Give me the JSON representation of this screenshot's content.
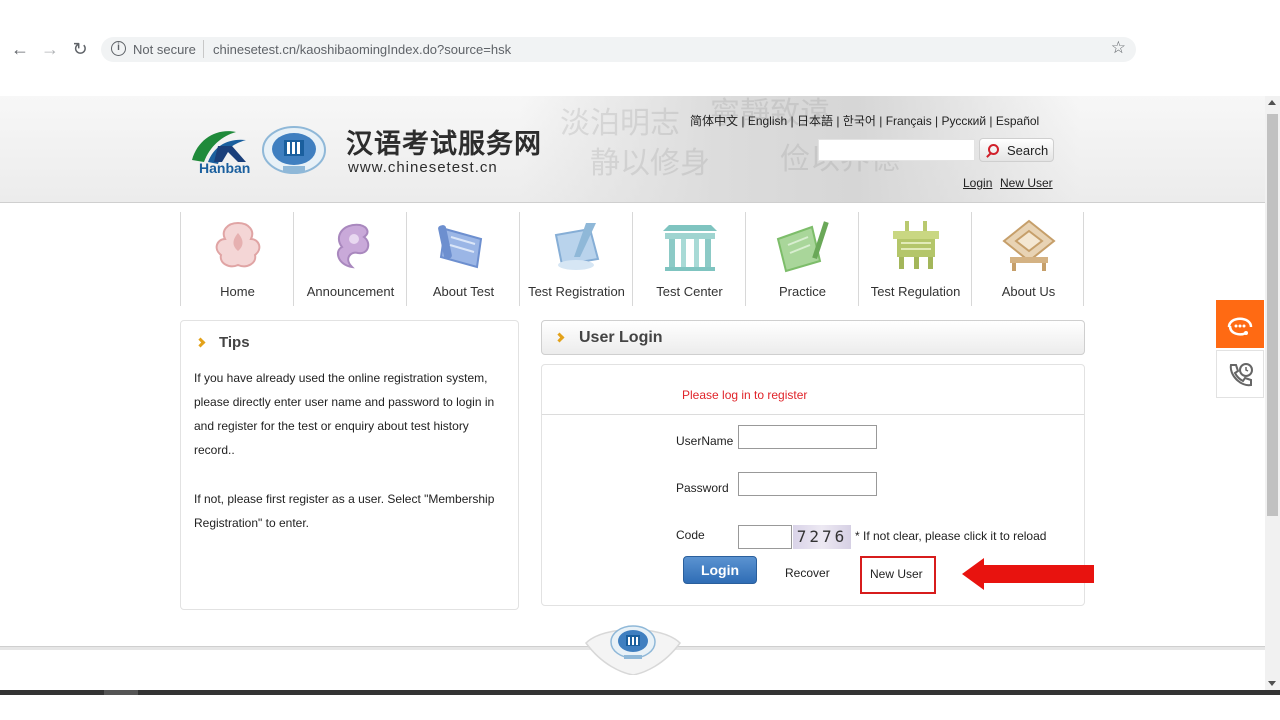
{
  "browser": {
    "security_label": "Not secure",
    "url": "chinesetest.cn/kaoshibaomingIndex.do?source=hsk"
  },
  "header": {
    "logo_text": "Hanban",
    "site_title": "汉语考试服务网",
    "site_url": "www.chinesetest.cn",
    "languages": [
      "简体中文",
      "English",
      "日本語",
      "한국어",
      "Français",
      "Русский",
      "Español"
    ],
    "search_label": "Search",
    "login_label": "Login",
    "new_user_label": "New User"
  },
  "nav": {
    "items": [
      {
        "label": "Home",
        "icon": "home-icon"
      },
      {
        "label": "Announcement",
        "icon": "announcement-icon"
      },
      {
        "label": "About Test",
        "icon": "scroll-icon"
      },
      {
        "label": "Test Registration",
        "icon": "registration-icon"
      },
      {
        "label": "Test Center",
        "icon": "gate-icon"
      },
      {
        "label": "Practice",
        "icon": "brush-icon"
      },
      {
        "label": "Test Regulation",
        "icon": "bronze-vessel-icon"
      },
      {
        "label": "About Us",
        "icon": "seal-icon"
      }
    ]
  },
  "tips": {
    "title": "Tips",
    "paragraph1": "If you have already used the online registration system, please directly enter user name and password to login in and register for the test or enquiry about test history record..",
    "paragraph2": "If not, please first register as a user. Select \"Membership Registration\" to enter."
  },
  "login": {
    "title": "User Login",
    "notice": "Please log in to register",
    "username_label": "UserName",
    "password_label": "Password",
    "code_label": "Code",
    "captcha_value": "7276",
    "captcha_hint": "*  If not clear, please click it to reload",
    "login_button": "Login",
    "recover_label": "Recover",
    "new_user_label": "New User"
  },
  "colors": {
    "accent_orange": "#ff6a13",
    "notice_red": "#e0242a",
    "annotation_red": "#e8130f",
    "login_blue": "#2f6db5"
  }
}
